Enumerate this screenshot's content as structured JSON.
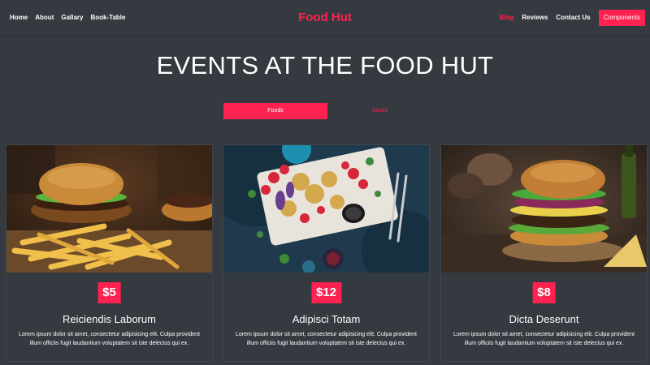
{
  "nav": {
    "left_links": [
      "Home",
      "About",
      "Gallary",
      "Book-Table"
    ],
    "brand": "Food Hut",
    "right_links": [
      "Blog",
      "Reviews",
      "Contact Us"
    ],
    "components_button": "Components"
  },
  "hero": {
    "title": "EVENTS AT THE FOOD HUT"
  },
  "tabs": {
    "foods": "Foods",
    "juices": "Juices"
  },
  "cards": [
    {
      "price": "$5",
      "title": "Reiciendis Laborum",
      "text": "Lorem ipsum dolor sit amet, consectetur adipisicing elit. Culpa provident illum officiis fugit laudantium voluptatem sit iste delectus qui ex.",
      "image": "burger-fries-photo"
    },
    {
      "price": "$12",
      "title": "Adipisci Totam",
      "text": "Lorem ipsum dolor sit amet, consectetur adipisicing elit. Culpa provident illum officiis fugit laudantium voluptatem sit iste delectus qui ex.",
      "image": "platter-photo"
    },
    {
      "price": "$8",
      "title": "Dicta Deserunt",
      "text": "Lorem ipsum dolor sit amet, consectetur adipisicing elit. Culpa provident illum officiis fugit laudantium voluptatem sit iste delectus qui ex.",
      "image": "burger-photo"
    }
  ],
  "colors": {
    "accent": "#ff214f",
    "background": "#343a40"
  }
}
